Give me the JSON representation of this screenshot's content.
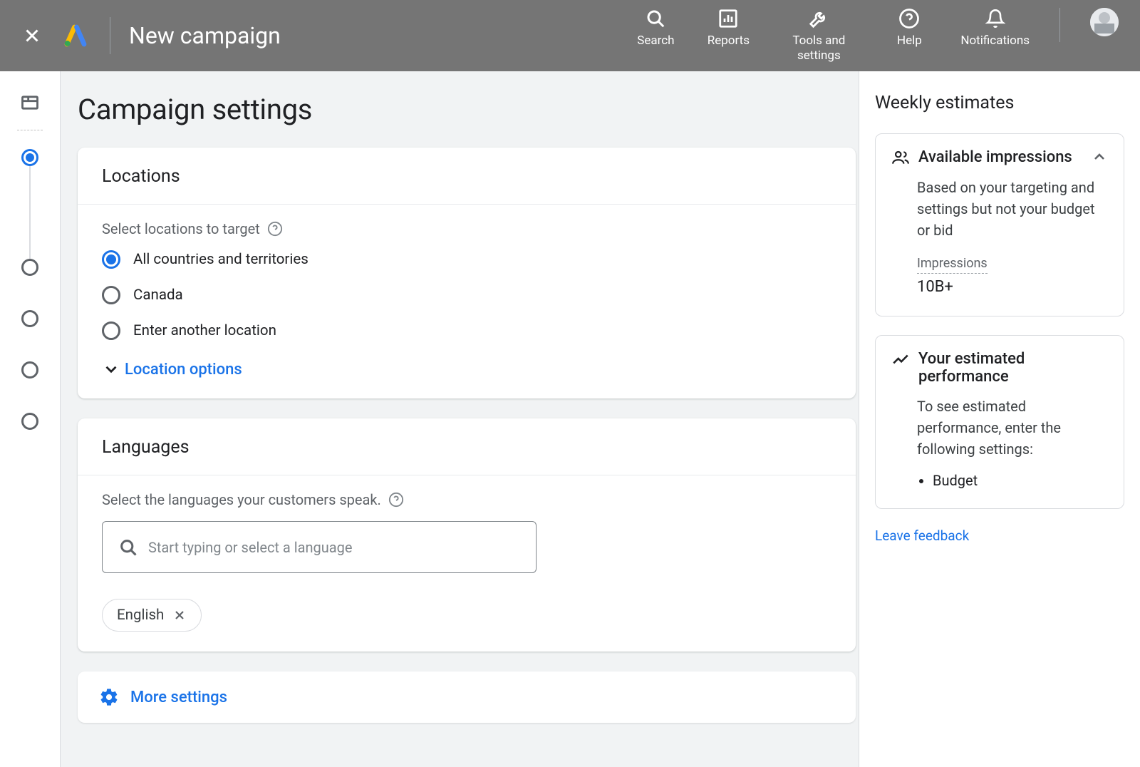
{
  "header": {
    "title": "New campaign",
    "nav": [
      {
        "label": "Search",
        "icon": "search-icon"
      },
      {
        "label": "Reports",
        "icon": "chart-icon"
      },
      {
        "label": "Tools and settings",
        "icon": "wrench-icon"
      },
      {
        "label": "Help",
        "icon": "help-icon"
      },
      {
        "label": "Notifications",
        "icon": "bell-icon"
      }
    ]
  },
  "main": {
    "heading": "Campaign settings",
    "locations": {
      "title": "Locations",
      "subtitle": "Select locations to target",
      "options": [
        "All countries and territories",
        "Canada",
        "Enter another location"
      ],
      "selectedIndex": 0,
      "expand_label": "Location options"
    },
    "languages": {
      "title": "Languages",
      "subtitle": "Select the languages your customers speak.",
      "placeholder": "Start typing or select a language",
      "chips": [
        "English"
      ]
    },
    "more_settings_label": "More settings"
  },
  "right": {
    "heading": "Weekly estimates",
    "impressions": {
      "title": "Available impressions",
      "desc": "Based on your targeting and settings but not your budget or bid",
      "metric_label": "Impressions",
      "metric_value": "10B+"
    },
    "performance": {
      "title": "Your estimated performance",
      "desc": "To see estimated performance, enter the following settings:",
      "bullets": [
        "Budget"
      ]
    },
    "feedback_label": "Leave feedback"
  }
}
